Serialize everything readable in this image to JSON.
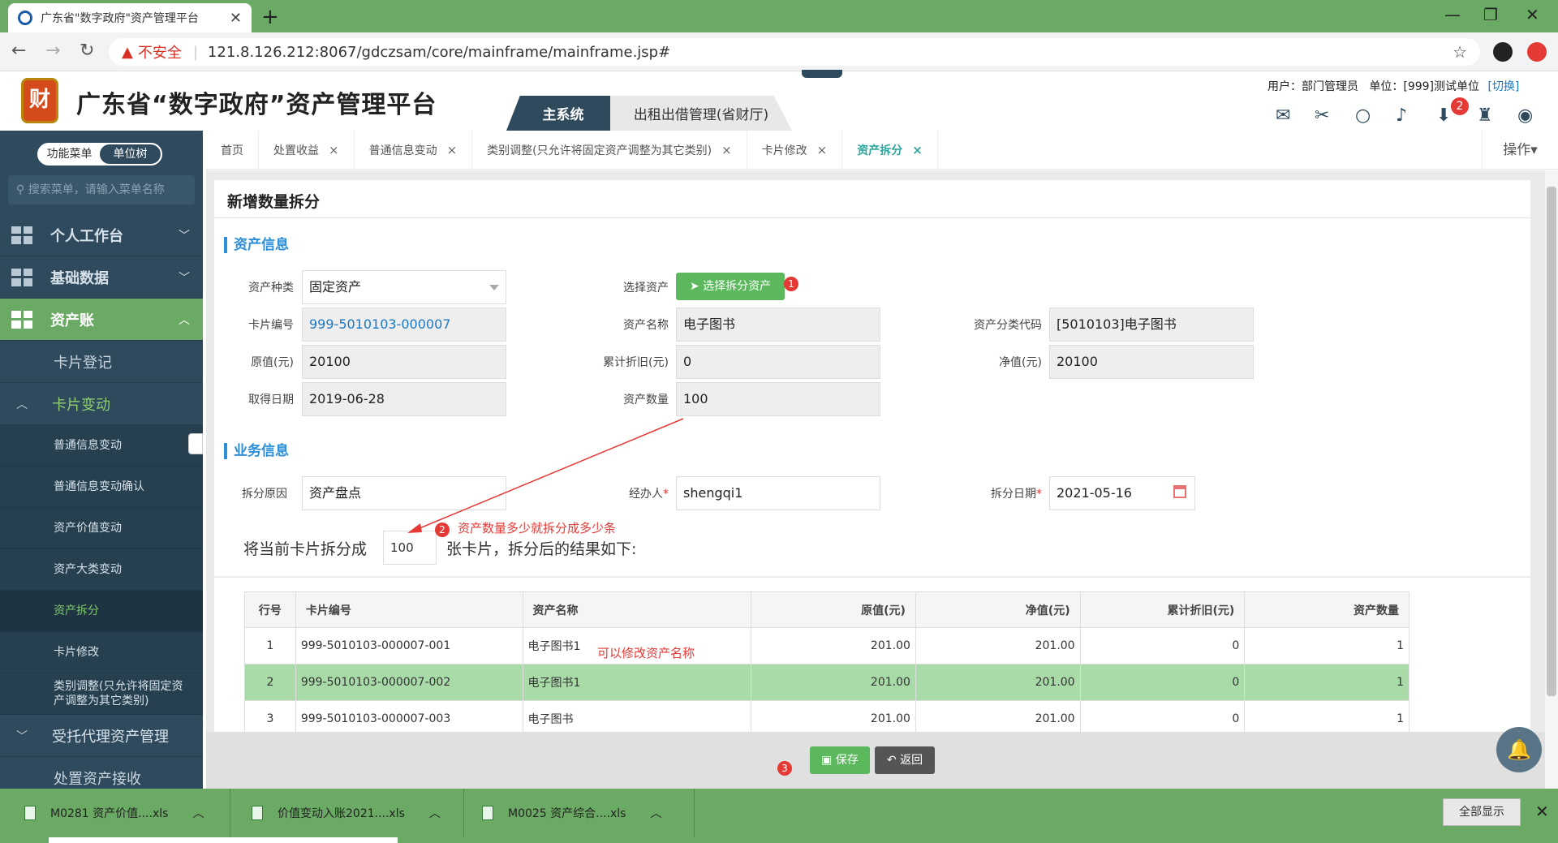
{
  "browser": {
    "tab_title": "广东省\"数字政府\"资产管理平台",
    "tab_close": "✕",
    "new_tab": "+",
    "insecure": "不安全",
    "separator": "|",
    "url": "121.8.126.212:8067/gdczsam/core/mainframe/mainframe.jsp#"
  },
  "header": {
    "logo_text": "财",
    "title": "广东省“数字政府”资产管理平台",
    "sys_tab_main": "主系统",
    "sys_tab_rent": "出租出借管理(省财厅)",
    "user_label": "用户：部门管理员",
    "unit_label": "单位：[999]测试单位",
    "switch_label": "[切换]",
    "download_badge": "2"
  },
  "sidebar": {
    "seg_menu": "功能菜单",
    "seg_unit": "单位树",
    "search_placeholder": "搜索菜单，请输入菜单名称",
    "nav": [
      {
        "label": "个人工作台"
      },
      {
        "label": "基础数据"
      },
      {
        "label": "资产账"
      }
    ],
    "sub": [
      {
        "label": "卡片登记"
      },
      {
        "label": "卡片变动"
      }
    ],
    "leaves": [
      {
        "label": "普通信息变动"
      },
      {
        "label": "普通信息变动确认"
      },
      {
        "label": "资产价值变动"
      },
      {
        "label": "资产大类变动"
      },
      {
        "label": "资产拆分"
      },
      {
        "label": "卡片修改"
      },
      {
        "label": "类别调整(只允许将固定资产调整为其它类别)"
      }
    ],
    "bottom": [
      {
        "label": "受托代理资产管理"
      },
      {
        "label": "处置资产接收"
      }
    ]
  },
  "tabs": [
    {
      "label": "首页"
    },
    {
      "label": "处置收益"
    },
    {
      "label": "普通信息变动"
    },
    {
      "label": "类别调整(只允许将固定资产调整为其它类别)"
    },
    {
      "label": "卡片修改"
    },
    {
      "label": "资产拆分"
    }
  ],
  "tab_close": "×",
  "ops_label": "操作▾",
  "form": {
    "title": "新增数量拆分",
    "section_asset": "资产信息",
    "section_business": "业务信息",
    "asset_type_label": "资产种类",
    "asset_type_value": "固定资产",
    "select_asset_label": "选择资产",
    "select_asset_btn": "选择拆分资产",
    "card_no_label": "卡片编号",
    "card_no_value": "999-5010103-000007",
    "asset_name_label": "资产名称",
    "asset_name_value": "电子图书",
    "class_code_label": "资产分类代码",
    "class_code_value": "[5010103]电子图书",
    "orig_value_label": "原值(元)",
    "orig_value_value": "20100",
    "acc_dep_label": "累计折旧(元)",
    "acc_dep_value": "0",
    "net_value_label": "净值(元)",
    "net_value_value": "20100",
    "acquire_date_label": "取得日期",
    "acquire_date_value": "2019-06-28",
    "qty_label": "资产数量",
    "qty_value": "100",
    "reason_label": "拆分原因",
    "reason_value": "资产盘点",
    "handler_label": "经办人",
    "handler_value": "shengqi1",
    "split_date_label": "拆分日期",
    "split_date_value": "2021-05-16",
    "required_mark": "*",
    "split_prefix": "将当前卡片拆分成",
    "split_count": "100",
    "split_suffix": "张卡片，拆分后的结果如下:"
  },
  "annotations": {
    "badge1": "1",
    "badge2": "2",
    "badge3": "3",
    "note_split": "资产数量多少就拆分成多少条",
    "note_name": "可以修改资产名称"
  },
  "table": {
    "headers": [
      "行号",
      "卡片编号",
      "资产名称",
      "原值(元)",
      "净值(元)",
      "累计折旧(元)",
      "资产数量"
    ],
    "rows": [
      [
        "1",
        "999-5010103-000007-001",
        "电子图书1",
        "201.00",
        "201.00",
        "0",
        "1"
      ],
      [
        "2",
        "999-5010103-000007-002",
        "电子图书1",
        "201.00",
        "201.00",
        "0",
        "1"
      ],
      [
        "3",
        "999-5010103-000007-003",
        "电子图书",
        "201.00",
        "201.00",
        "0",
        "1"
      ]
    ]
  },
  "buttons": {
    "save": "保存",
    "back": "返回"
  },
  "downloads": {
    "items": [
      {
        "label": "M0281 资产价值....xls"
      },
      {
        "label": "价值变动入账2021....xls"
      },
      {
        "label": "M0025 资产综合....xls"
      }
    ],
    "show_all": "全部显示",
    "close": "✕"
  },
  "colors": {
    "chrome_green": "#6aaa64",
    "sidebar_bg": "#2e4a5c",
    "accent_teal": "#2aa6a0",
    "section_blue": "#2b8fd8",
    "selected_row": "#a8dba8",
    "annotation_red": "#e53935"
  }
}
